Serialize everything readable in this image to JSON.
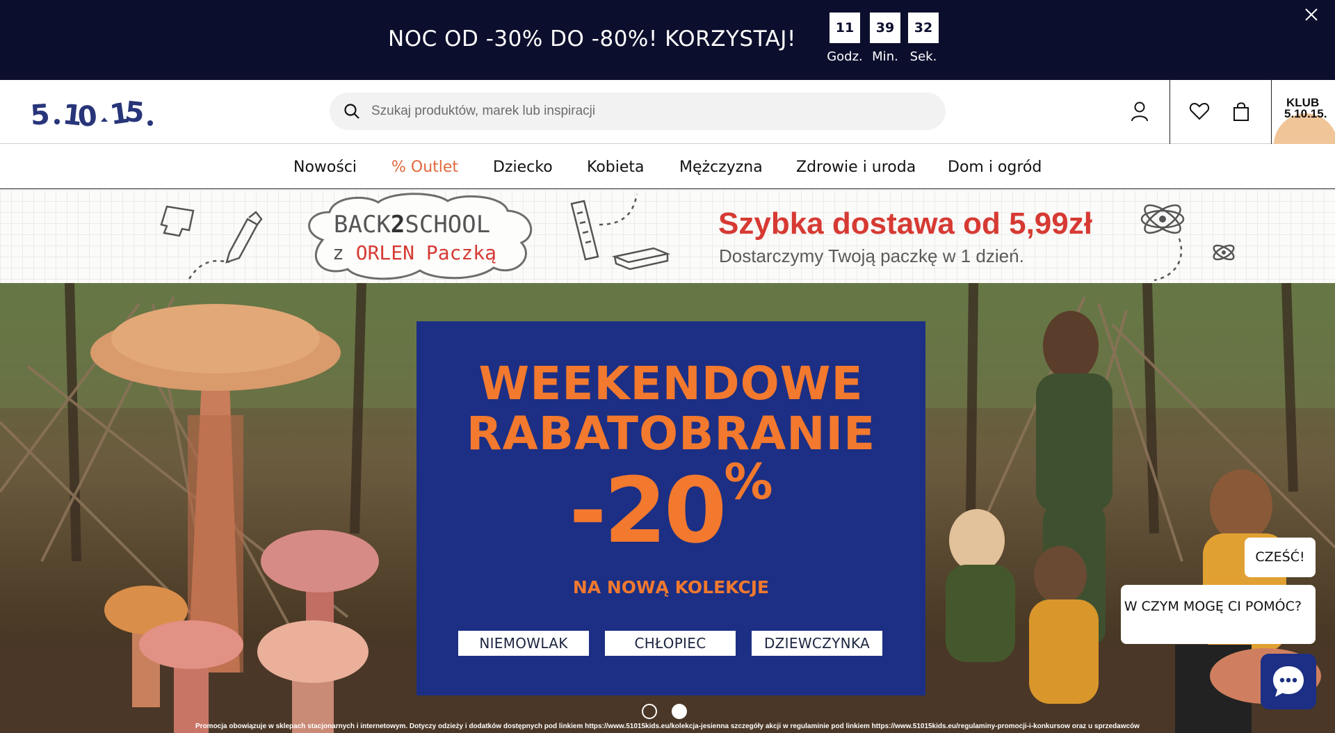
{
  "promo_bar": {
    "text": "NOC OD -30% DO -80%! KORZYSTAJ!",
    "timer": [
      {
        "value": "11",
        "label": "Godz."
      },
      {
        "value": "39",
        "label": "Min."
      },
      {
        "value": "32",
        "label": "Sek."
      }
    ],
    "close_icon": "close-icon"
  },
  "header": {
    "logo": "5.10.15.",
    "search": {
      "placeholder": "Szukaj produktów, marek lub inspiracji",
      "icon": "search-icon"
    },
    "icons": [
      "user-icon",
      "heart-icon",
      "shopping-bag-icon"
    ],
    "club": {
      "line1": "KLUB",
      "line2": "5.10.15."
    }
  },
  "nav": {
    "items": [
      {
        "label": "Nowości"
      },
      {
        "label": "% Outlet"
      },
      {
        "label": "Dziecko"
      },
      {
        "label": "Kobieta"
      },
      {
        "label": "Mężczyzna"
      },
      {
        "label": "Zdrowie i uroda"
      },
      {
        "label": "Dom i ogród"
      }
    ]
  },
  "delivery_banner": {
    "b2s_line1": "BACK",
    "b2s_two": "2",
    "b2s_line1b": "SCHOOL",
    "b2s_z": "z",
    "b2s_line2": "ORLEN Paczką",
    "title": "Szybka dostawa od 5,99zł",
    "subtitle": "Dostarczymy Twoją paczkę w 1 dzień."
  },
  "hero": {
    "title_line1": "WEEKENDOWE",
    "title_line2": "RABATOBRANIE",
    "discount": "-20",
    "percent": "%",
    "subtitle": "NA NOWĄ KOLEKCJE",
    "buttons": [
      {
        "label": "NIEMOWLAK"
      },
      {
        "label": "CHŁOPIEC"
      },
      {
        "label": "DZIEWCZYNKA"
      }
    ],
    "slides_total": 2,
    "disclaimer": "Promocja obowiązuje w sklepach stacjonarnych i internetowym. Dotyczy odzieży i dodatków dostępnych pod linkiem https://www.51015kids.eu/kolekcja-jesienna szczegóły akcji w regulaminie pod linkiem https://www.51015kids.eu/regulaminy-promocji-i-konkursow oraz u sprzedawców"
  },
  "chat": {
    "greeting": "CZEŚĆ!",
    "question": "W CZYM MOGĘ CI POMÓC?",
    "icon": "chat-icon"
  },
  "colors": {
    "promo_bg": "#0c0e2d",
    "brand_navy": "#1c2f84",
    "accent_orange": "#f2792e",
    "outlet_orange": "#e0683b",
    "delivery_red": "#d63a33"
  }
}
